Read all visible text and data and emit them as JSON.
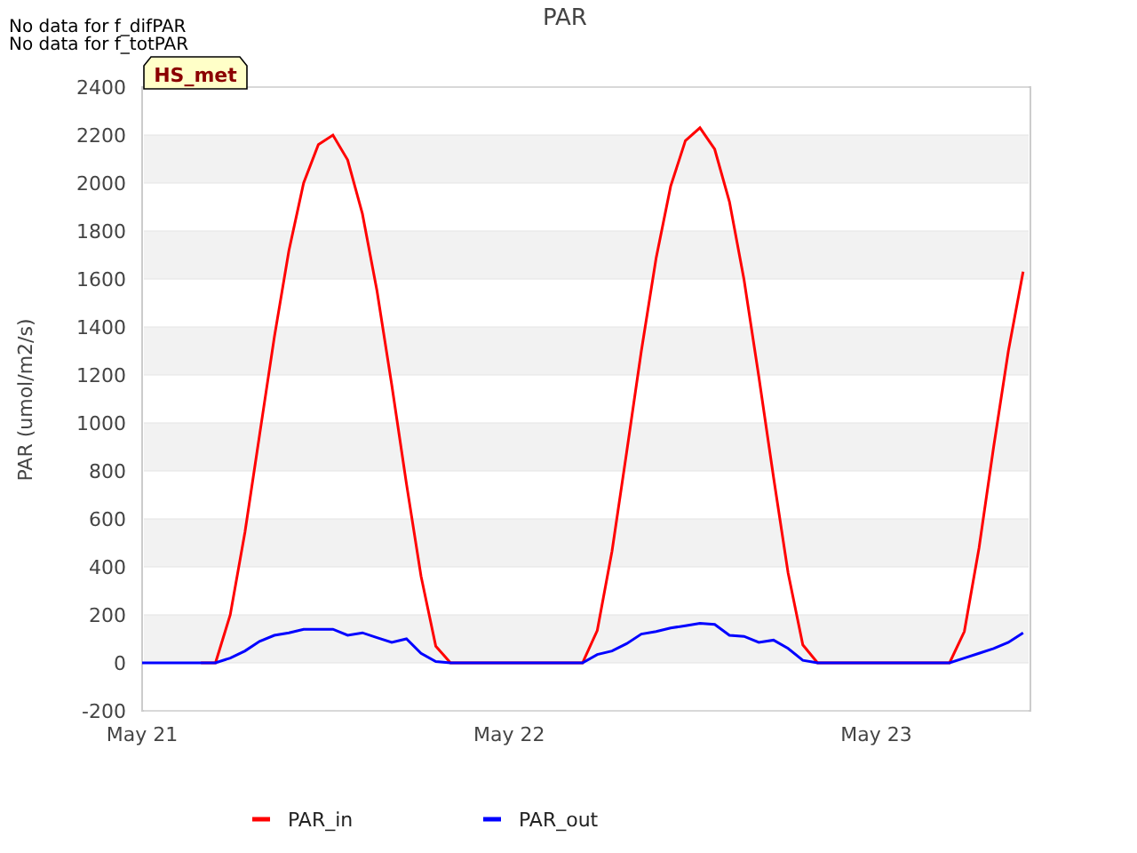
{
  "notices": [
    "No data for f_difPAR",
    "No data for f_totPAR"
  ],
  "tag": "HS_met",
  "chart_data": {
    "type": "line",
    "title": "PAR",
    "ylabel": "PAR (umol/m2/s)",
    "categories": [
      "May 21",
      null,
      null,
      null,
      null,
      null,
      null,
      null,
      null,
      null,
      null,
      null,
      null,
      null,
      null,
      null,
      null,
      null,
      null,
      null,
      null,
      null,
      null,
      null,
      null,
      "May 22",
      null,
      null,
      null,
      null,
      null,
      null,
      null,
      null,
      null,
      null,
      null,
      null,
      null,
      null,
      null,
      null,
      null,
      null,
      null,
      null,
      null,
      null,
      null,
      null,
      "May 23",
      null,
      null,
      null,
      null,
      null,
      null,
      null,
      null,
      null,
      null
    ],
    "series": [
      {
        "name": "PAR_in",
        "color": "#ff0000",
        "values": [
          null,
          null,
          null,
          null,
          0,
          0,
          200,
          545,
          950,
          1357,
          1718,
          2000,
          2160,
          2200,
          2096,
          1872,
          1551,
          1159,
          746,
          361,
          70,
          0,
          0,
          0,
          0,
          0,
          0,
          0,
          0,
          0,
          0,
          135,
          466,
          876,
          1300,
          1686,
          1987,
          2176,
          2230,
          2141,
          1922,
          1597,
          1195,
          774,
          375,
          75,
          0,
          0,
          0,
          0,
          0,
          0,
          0,
          0,
          0,
          0,
          130,
          480,
          900,
          1300,
          1630
        ]
      },
      {
        "name": "PAR_out",
        "color": "#0000ff",
        "values": [
          0,
          0,
          0,
          0,
          0,
          0,
          20,
          50,
          90,
          115,
          125,
          140,
          140,
          140,
          115,
          125,
          105,
          85,
          100,
          40,
          5,
          0,
          0,
          0,
          0,
          0,
          0,
          0,
          0,
          0,
          0,
          35,
          50,
          80,
          120,
          130,
          145,
          155,
          165,
          160,
          115,
          110,
          85,
          95,
          60,
          10,
          0,
          0,
          0,
          0,
          0,
          0,
          0,
          0,
          0,
          0,
          20,
          40,
          60,
          85,
          125
        ]
      }
    ],
    "ylim": [
      -200,
      2400
    ],
    "grid": true,
    "legend": true,
    "yticks": [
      -200,
      0,
      200,
      400,
      600,
      800,
      1000,
      1200,
      1400,
      1600,
      1800,
      2000,
      2200,
      2400
    ]
  }
}
